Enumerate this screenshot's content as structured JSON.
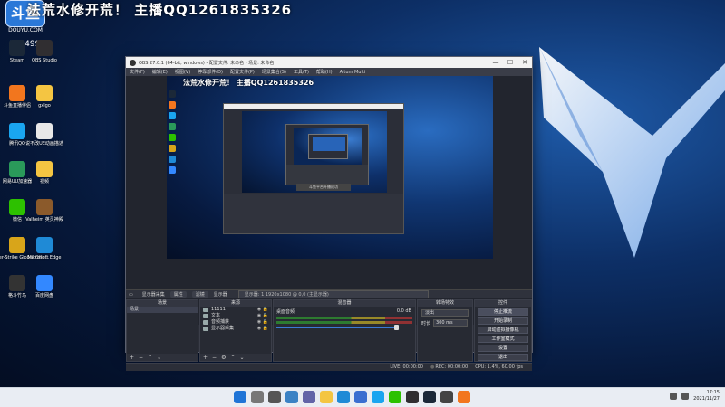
{
  "overlay": {
    "title": "法荒水修开荒！  主播QQ1261835326",
    "watermark_logo": "斗鱼",
    "watermark_text": "DOUYU.COM",
    "room_id": "10349948"
  },
  "desktop_icons": [
    {
      "label": "Steam",
      "color": "#1b2838"
    },
    {
      "label": "OBS Studio",
      "color": "#302e31"
    },
    {
      "label": "斗鱼直播伴侣",
      "color": "#f2761e"
    },
    {
      "label": "gxlgo",
      "color": "#f4c542"
    },
    {
      "label": "腾讯QQ",
      "color": "#1aa5f0"
    },
    {
      "label": "说不改UE动画描述",
      "color": "#e8e8e8"
    },
    {
      "label": "网易UU加速器",
      "color": "#2a9a5a"
    },
    {
      "label": "视频",
      "color": "#f4c542"
    },
    {
      "label": "微信",
      "color": "#2dc100"
    },
    {
      "label": "Valheim 英灵神殿",
      "color": "#8b5a2b"
    },
    {
      "label": "Counter-Strike Global Offe...",
      "color": "#d8a51a"
    },
    {
      "label": "Microsoft Edge",
      "color": "#1f8ad6"
    },
    {
      "label": "格斗竹鸟",
      "color": "#333333"
    },
    {
      "label": "百度网盘",
      "color": "#3388ff"
    }
  ],
  "obs": {
    "title": "OBS 27.0.1 (64-bit, windows) - 配置文件: 未命名 - 场景: 未命名",
    "window_controls": [
      "—",
      "☐",
      "✕"
    ],
    "menu": [
      "文件(F)",
      "编辑(E)",
      "视图(V)",
      "停靠部件(D)",
      "配置文件(P)",
      "场景集合(S)",
      "工具(T)",
      "帮助(H)",
      "Aitum Multi"
    ],
    "preview_title": "法荒水修开荒！  主播QQ1261835326",
    "nested_toast": "斗鱼平台开播成功",
    "scene_bar": {
      "scene_name": "显示器采集",
      "properties": "属性",
      "filters": "滤镜",
      "display_label": "显示器",
      "display_value": "显示器: 1 1920x1080 @ 0,0 (主显示器)"
    },
    "docks": {
      "scenes_title": "场景",
      "sources_title": "来源",
      "mixer_title": "混音器",
      "transitions_title": "转场特效",
      "controls_title": "控件"
    },
    "scenes": [
      "场景"
    ],
    "sources": [
      {
        "name": "11111"
      },
      {
        "name": "文本"
      },
      {
        "name": "音频捕获"
      },
      {
        "name": "显示器采集"
      }
    ],
    "mixer": [
      {
        "name": "桌面音频",
        "db": "0.0 dB"
      }
    ],
    "transition": {
      "type": "淡出",
      "duration_label": "时长",
      "duration_value": "300 ms"
    },
    "controls": [
      "停止推流",
      "开始录制",
      "启动虚拟摄像机",
      "工作室模式",
      "设置",
      "退出"
    ],
    "status": {
      "live": "LIVE: 00:00:00",
      "rec": "REC: 00:00:00",
      "cpu": "CPU: 1.4%, 60.00 fps"
    }
  },
  "taskbar": {
    "apps": [
      {
        "name": "windows-start",
        "color": "#1f74d6"
      },
      {
        "name": "search",
        "color": "#777777"
      },
      {
        "name": "task-view",
        "color": "#555555"
      },
      {
        "name": "widgets",
        "color": "#3b82c4"
      },
      {
        "name": "chat",
        "color": "#6264a7"
      },
      {
        "name": "explorer",
        "color": "#f4c542"
      },
      {
        "name": "edge",
        "color": "#1f8ad6"
      },
      {
        "name": "store",
        "color": "#3a6ed0"
      },
      {
        "name": "qq",
        "color": "#1aa5f0"
      },
      {
        "name": "wechat",
        "color": "#2dc100"
      },
      {
        "name": "obs",
        "color": "#302e31"
      },
      {
        "name": "steam",
        "color": "#1b2838"
      },
      {
        "name": "game",
        "color": "#444444"
      },
      {
        "name": "douyu",
        "color": "#f2761e"
      }
    ],
    "time": "17:15",
    "date": "2021/11/27"
  }
}
